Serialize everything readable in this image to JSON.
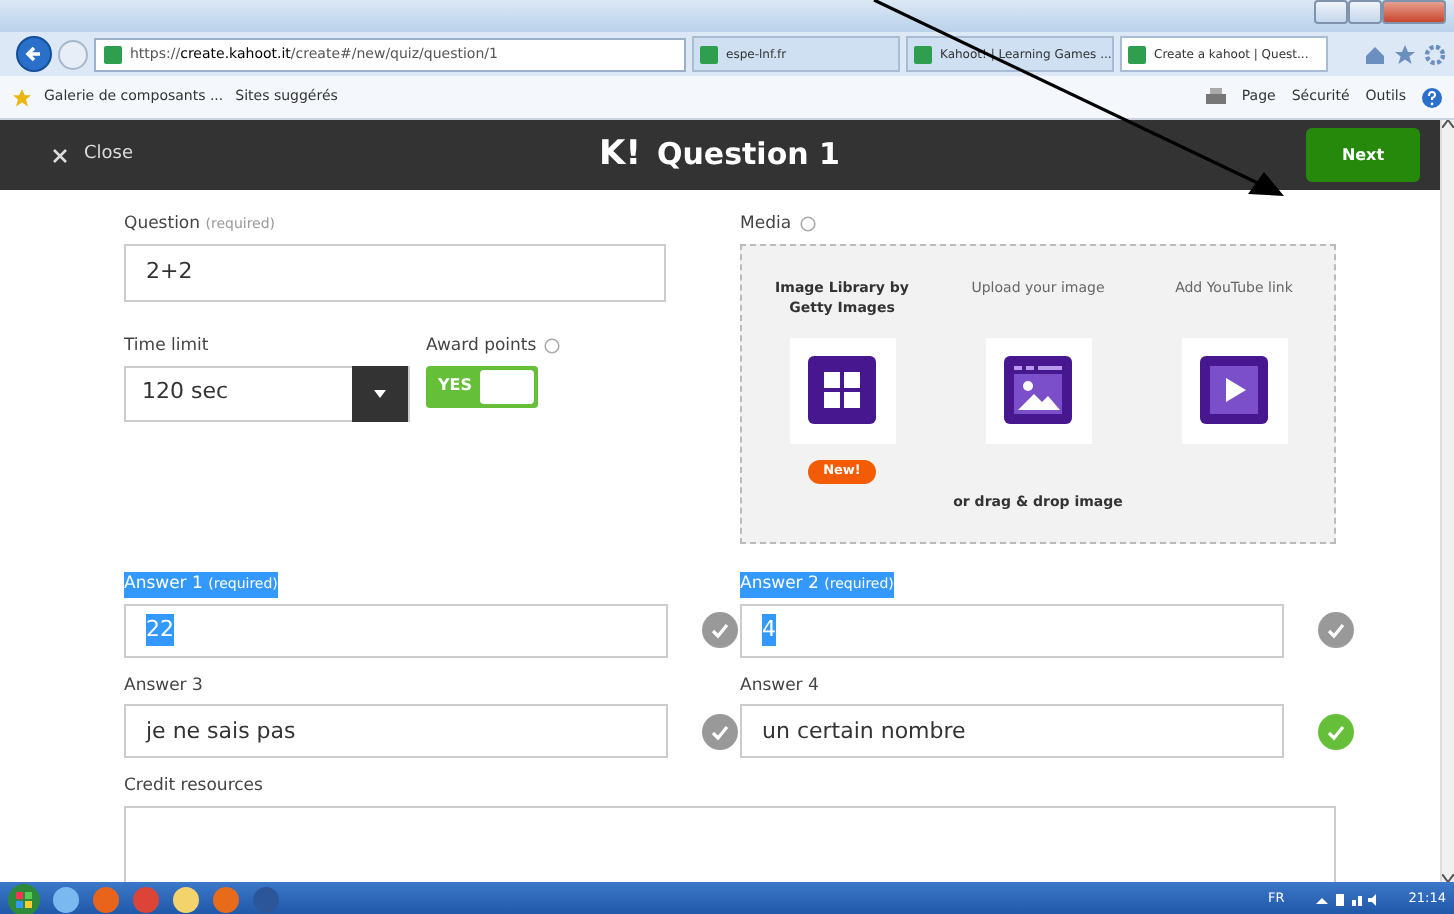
{
  "browser": {
    "address": "https://**create.kahoot.it**/create#/new/quiz/question/1",
    "tabs": [
      {
        "label": "espe-lnf.fr",
        "selected": false
      },
      {
        "label": "Kahoot! | Learning Games ...",
        "selected": false
      },
      {
        "label": "Create a kahoot | Quest...",
        "selected": true
      }
    ],
    "favorites": [
      "Galerie de composants ...",
      "Sites suggérés"
    ],
    "commands": [
      "Page",
      "Sécurité",
      "Outils"
    ]
  },
  "header": {
    "close": "Close",
    "logo": "K!",
    "title": "Question 1",
    "next": "Next"
  },
  "question": {
    "label": "Question",
    "hint": "(required)",
    "value": "2+2"
  },
  "time_limit": {
    "label": "Time limit",
    "value": "120 sec"
  },
  "award_points": {
    "label": "Award points",
    "on": true,
    "on_text": "YES"
  },
  "media": {
    "label": "Media",
    "drop_text": "or drag & drop image",
    "options": [
      {
        "kind": "library",
        "label": "Image Library by Getty Images",
        "badge": "New!"
      },
      {
        "kind": "upload",
        "label": "Upload your image"
      },
      {
        "kind": "video",
        "label": "Add YouTube link"
      }
    ]
  },
  "answers": [
    {
      "label": "Answer 1",
      "hint": "(required)",
      "value": "22",
      "highlighted": true,
      "correct": false
    },
    {
      "label": "Answer 2",
      "hint": "(required)",
      "value": "4",
      "highlighted": true,
      "correct": false
    },
    {
      "label": "Answer 3",
      "value": "je ne sais pas",
      "highlighted": false,
      "correct": false
    },
    {
      "label": "Answer 4",
      "value": "un certain nombre",
      "highlighted": false,
      "correct": true
    }
  ],
  "credit": {
    "label": "Credit resources"
  },
  "taskbar": {
    "language": "FR",
    "time": "21:14"
  }
}
